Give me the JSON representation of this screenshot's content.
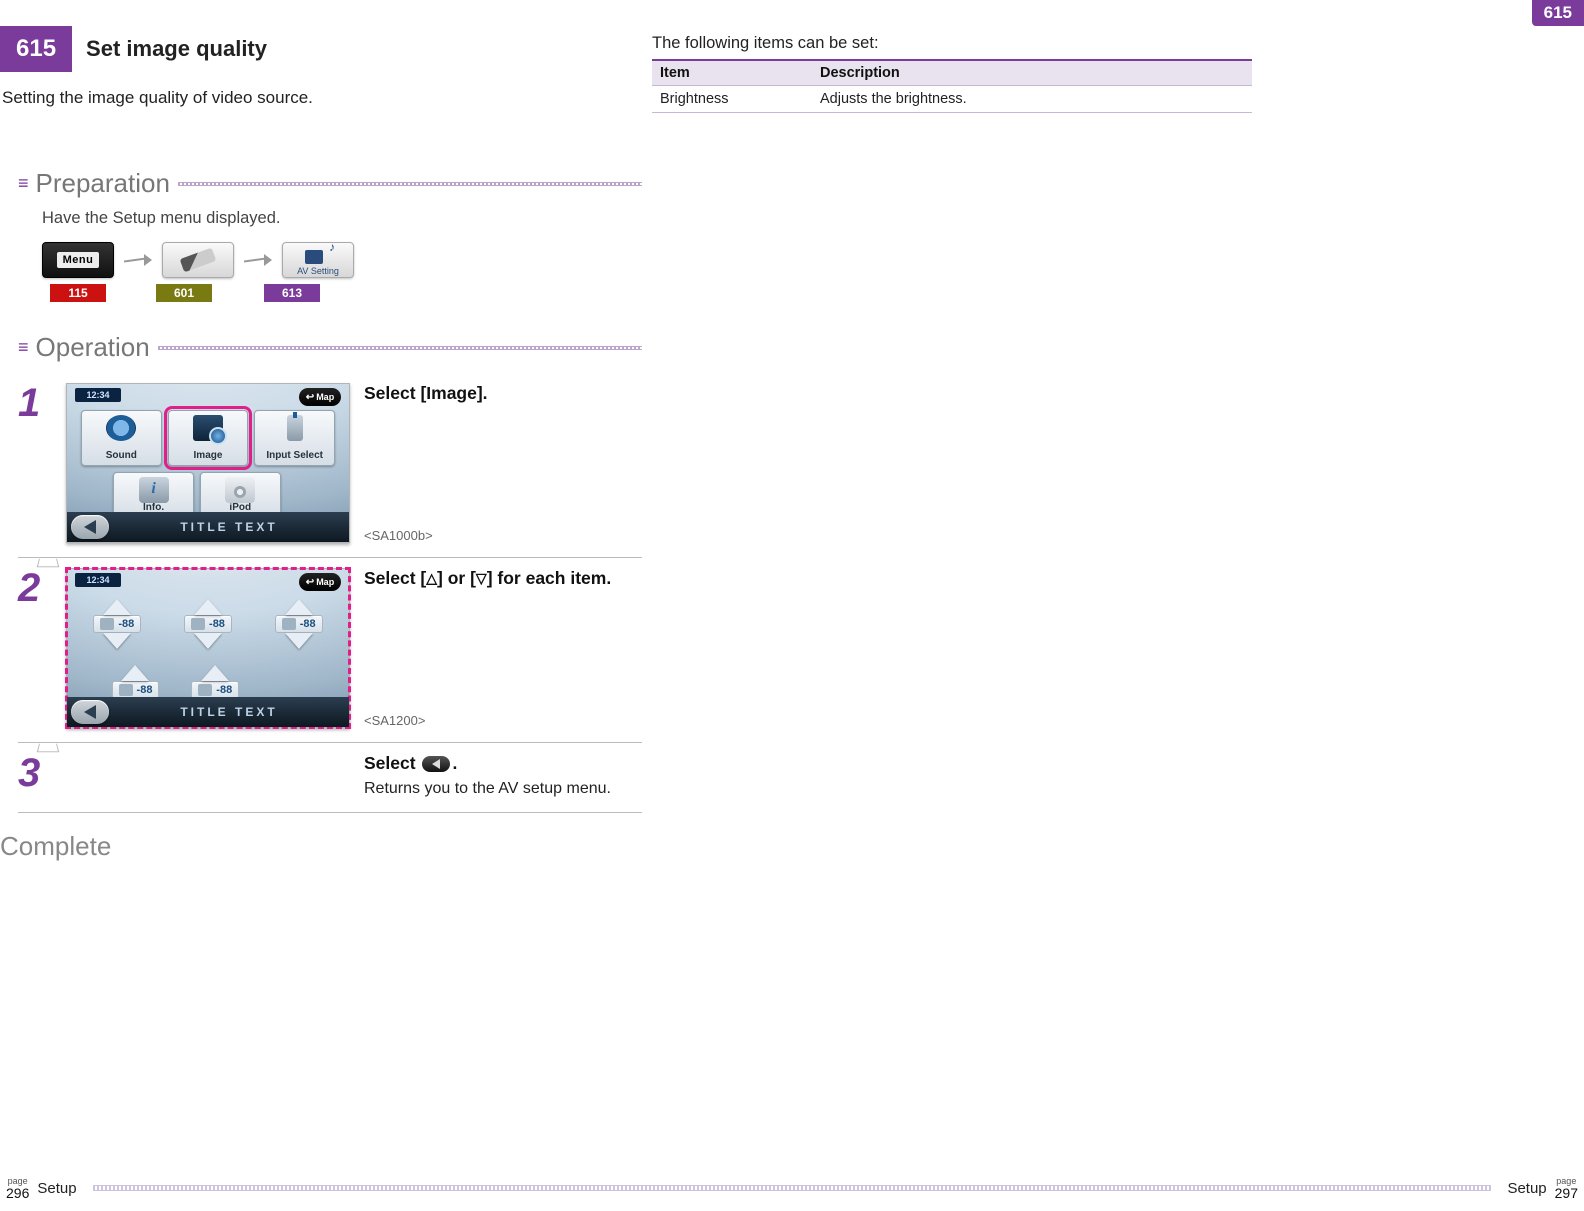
{
  "page_tab": "615",
  "header": {
    "badge": "615",
    "title": "Set image quality"
  },
  "intro": "Setting the image quality of video source.",
  "preparation": {
    "heading": "Preparation",
    "text": "Have the Setup menu displayed.",
    "menu_label": "Menu",
    "av_label": "AV Setting",
    "refs": {
      "r1": "115",
      "r2": "601",
      "r3": "613"
    }
  },
  "operation": {
    "heading": "Operation"
  },
  "screen": {
    "clock": "12:34",
    "map": "Map",
    "title_text": "TITLE TEXT",
    "tiles": {
      "sound": "Sound",
      "image": "Image",
      "input": "Input Select",
      "info": "Info.",
      "ipod": "iPod"
    },
    "ctrl_value": "-88"
  },
  "steps": {
    "s1": {
      "num": "1",
      "instr_a": "Select ",
      "instr_b": "[Image]",
      "instr_c": ".",
      "code": "<SA1000b>"
    },
    "s2": {
      "num": "2",
      "instr_a": "Select [",
      "tri_up": "△",
      "instr_b": "] or [",
      "tri_dn": "▽",
      "instr_c": "] for each item.",
      "code": "<SA1200>"
    },
    "s3": {
      "num": "3",
      "instr_a": "Select ",
      "instr_b": ".",
      "sub": "Returns you to the AV setup menu."
    }
  },
  "complete": "Complete",
  "right": {
    "intro": "The following items can be set:",
    "th_item": "Item",
    "th_desc": "Description",
    "rows": [
      {
        "item": "Brightness",
        "desc": "Adjusts the brightness."
      }
    ]
  },
  "footer": {
    "page_label": "page",
    "left_num": "296",
    "right_num": "297",
    "section": "Setup"
  }
}
